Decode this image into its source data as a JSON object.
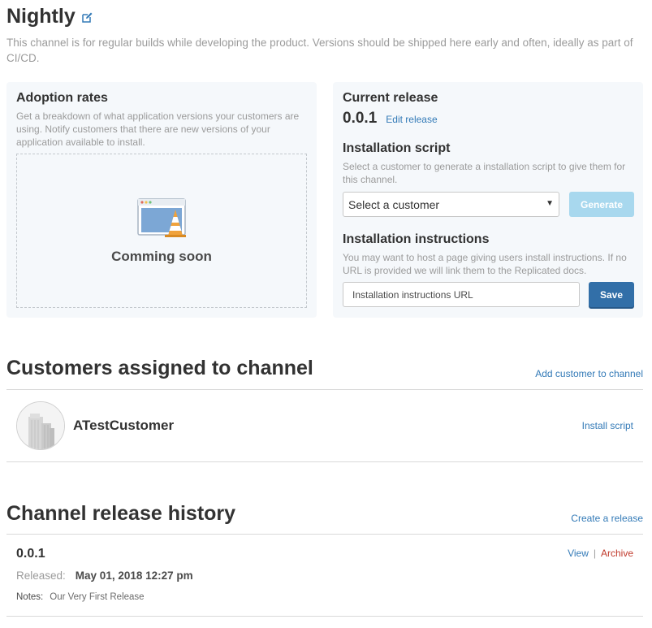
{
  "channel": {
    "title": "Nightly",
    "description": "This channel is for regular builds while developing the product. Versions should be shipped here early and often, ideally as part of CI/CD."
  },
  "adoption": {
    "title": "Adoption rates",
    "description": "Get a breakdown of what application versions your customers are using. Notify customers that there are new versions of your application available to install.",
    "coming_soon": "Comming soon"
  },
  "current_release": {
    "title": "Current release",
    "version": "0.0.1",
    "edit_label": "Edit release"
  },
  "installation_script": {
    "title": "Installation script",
    "description": "Select a customer to generate a installation script to give them for this channel.",
    "select_value": "Select a customer",
    "generate_label": "Generate"
  },
  "installation_instructions": {
    "title": "Installation instructions",
    "description": "You may want to host a page giving users install instructions. If no URL is provided we will link them to the Replicated docs.",
    "url_placeholder": "Installation instructions URL",
    "save_label": "Save"
  },
  "customers": {
    "title": "Customers assigned to channel",
    "add_label": "Add customer to channel",
    "items": [
      {
        "name": "ATestCustomer",
        "action_label": "Install script"
      }
    ]
  },
  "history": {
    "title": "Channel release history",
    "create_label": "Create a release",
    "items": [
      {
        "version": "0.0.1",
        "released_label": "Released:",
        "released_date": "May 01, 2018 12:27 pm",
        "notes_label": "Notes:",
        "notes": "Our Very First Release",
        "view_label": "View",
        "separator": "|",
        "archive_label": "Archive"
      }
    ]
  },
  "colors": {
    "link": "#337ab7",
    "archive": "#c0392b",
    "save_button": "#326fa8",
    "generate_button": "#a8d8ee",
    "panel_bg": "#f5f8fb"
  }
}
